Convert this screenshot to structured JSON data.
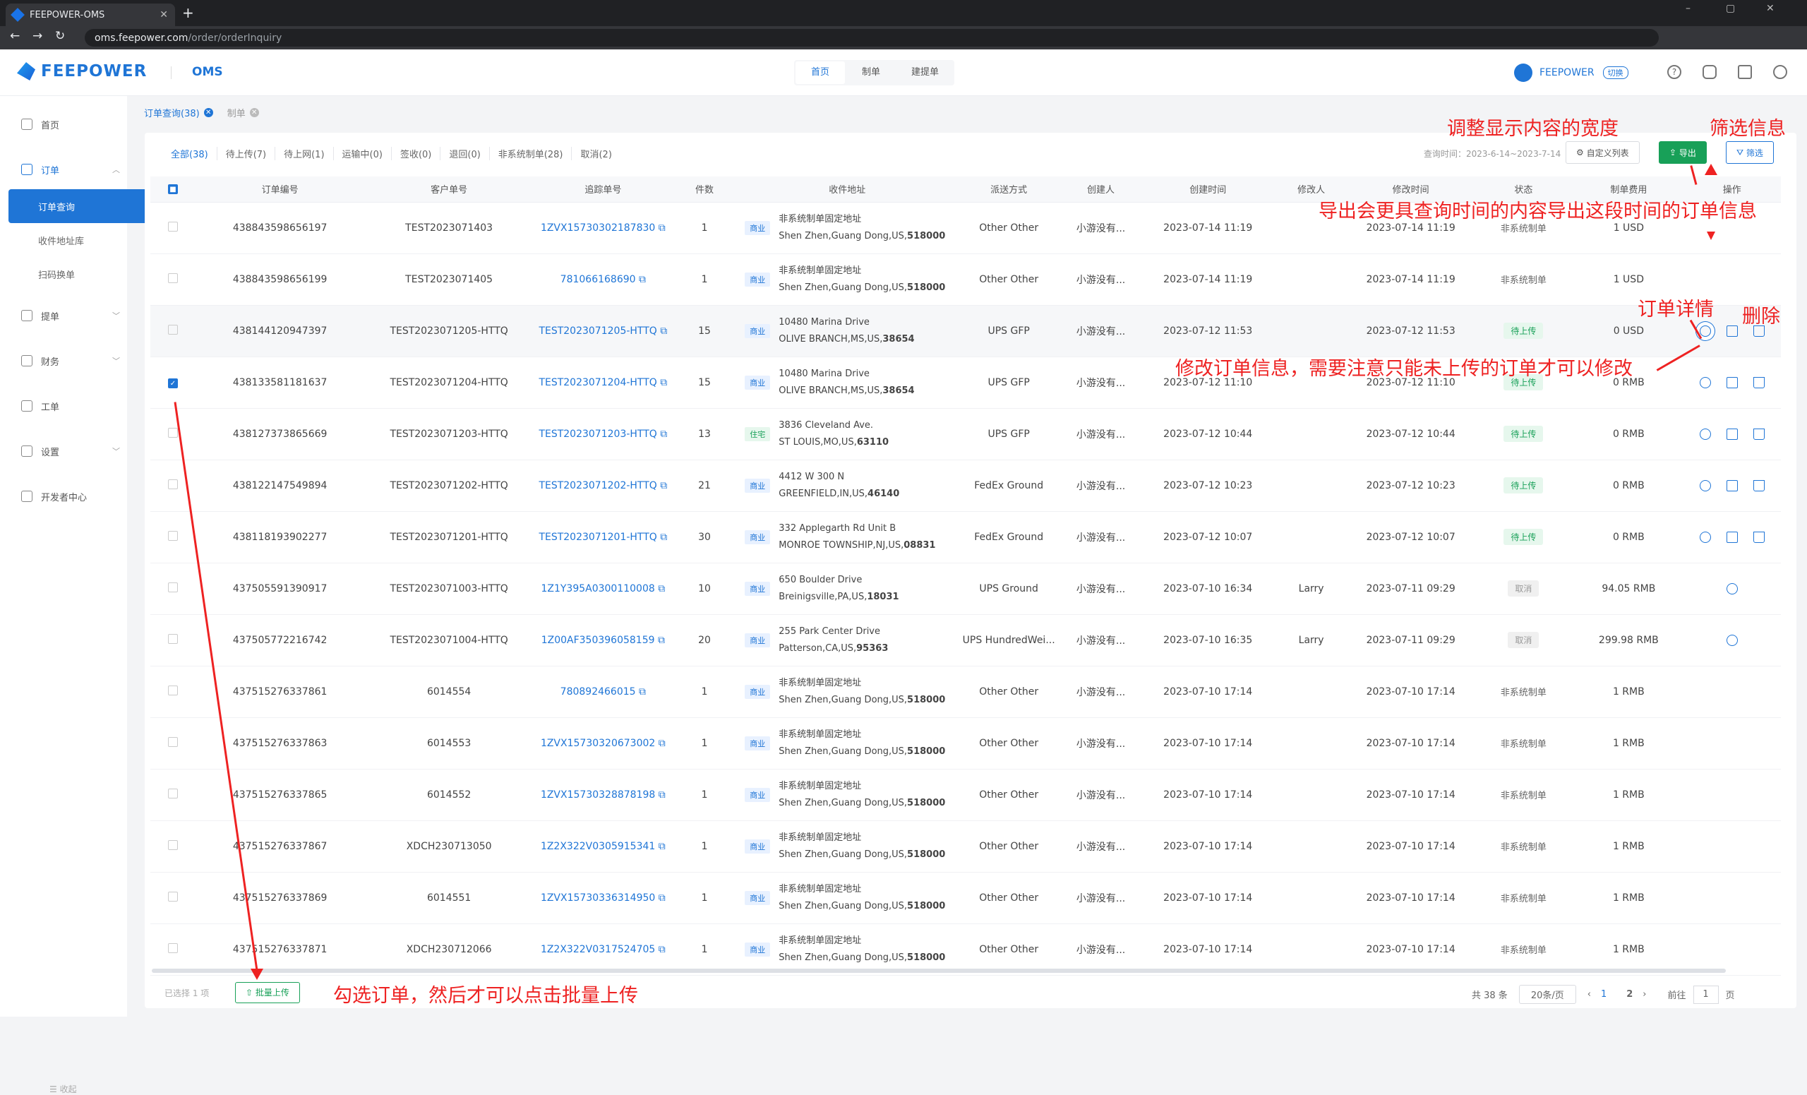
{
  "browser": {
    "tab_title": "FEEPOWER-OMS",
    "url_host": "oms.feepower.com",
    "url_path": "/order/orderInquiry"
  },
  "header": {
    "brand": "FEEPOWER",
    "product": "OMS",
    "nav": [
      "首页",
      "制单",
      "建提单"
    ],
    "user_name": "FEEPOWER",
    "switch_label": "切换"
  },
  "sidebar": {
    "items": [
      {
        "label": "首页",
        "icon": "home-icon"
      },
      {
        "label": "订单",
        "icon": "order-icon"
      },
      {
        "label": "提单",
        "icon": "bill-icon"
      },
      {
        "label": "财务",
        "icon": "finance-icon"
      },
      {
        "label": "工单",
        "icon": "ticket-icon"
      },
      {
        "label": "设置",
        "icon": "settings-icon"
      },
      {
        "label": "开发者中心",
        "icon": "developer-icon"
      }
    ],
    "sub_items": [
      "订单查询",
      "收件地址库",
      "扫码换单"
    ],
    "collapse_label": "收起"
  },
  "breadcrumbs": [
    "订单查询(38)",
    "制单"
  ],
  "filter_tabs": [
    "全部(38)",
    "待上传(7)",
    "待上网(1)",
    "运输中(0)",
    "签收(0)",
    "退回(0)",
    "非系统制单(28)",
    "取消(2)"
  ],
  "query_time": "查询时间：2023-6-14~2023-7-14",
  "toolbar": {
    "custom_columns": "自定义列表",
    "export": "导出",
    "filter": "筛选"
  },
  "columns": [
    "订单编号",
    "客户单号",
    "追踪单号",
    "件数",
    "收件地址",
    "派送方式",
    "创建人",
    "创建时间",
    "修改人",
    "修改时间",
    "状态",
    "制单费用",
    "操作"
  ],
  "rows": [
    {
      "checked": false,
      "id": "438843598656197",
      "cust": "TEST2023071403",
      "track": "1ZVX15730302187830",
      "qty": "1",
      "type": "商业",
      "addr1": "非系统制单固定地址",
      "addr2": "Shen Zhen,Guang Dong,US,",
      "zip": "518000",
      "method": "Other Other",
      "creator": "小游没有...",
      "created": "2023-07-14 11:19",
      "modifier": "",
      "modified": "2023-07-14 11:19",
      "status": "非系统制单",
      "status_kind": "none",
      "fee": "1 USD",
      "ops": 0
    },
    {
      "checked": false,
      "id": "438843598656199",
      "cust": "TEST2023071405",
      "track": "781066168690",
      "qty": "1",
      "type": "商业",
      "addr1": "非系统制单固定地址",
      "addr2": "Shen Zhen,Guang Dong,US,",
      "zip": "518000",
      "method": "Other Other",
      "creator": "小游没有...",
      "created": "2023-07-14 11:19",
      "modifier": "",
      "modified": "2023-07-14 11:19",
      "status": "非系统制单",
      "status_kind": "none",
      "fee": "1 USD",
      "ops": 0
    },
    {
      "checked": false,
      "id": "438144120947397",
      "cust": "TEST2023071205-HTTQ",
      "track": "TEST2023071205-HTTQ",
      "qty": "15",
      "type": "商业",
      "addr1": "10480 Marina Drive",
      "addr2": "OLIVE BRANCH,MS,US,",
      "zip": "38654",
      "method": "UPS GFP",
      "creator": "小游没有...",
      "created": "2023-07-12 11:53",
      "modifier": "",
      "modified": "2023-07-12 11:53",
      "status": "待上传",
      "status_kind": "up",
      "fee": "0 USD",
      "ops": 3,
      "hl": true
    },
    {
      "checked": true,
      "id": "438133581181637",
      "cust": "TEST2023071204-HTTQ",
      "track": "TEST2023071204-HTTQ",
      "qty": "15",
      "type": "商业",
      "addr1": "10480 Marina Drive",
      "addr2": "OLIVE BRANCH,MS,US,",
      "zip": "38654",
      "method": "UPS GFP",
      "creator": "小游没有...",
      "created": "2023-07-12 11:10",
      "modifier": "",
      "modified": "2023-07-12 11:10",
      "status": "待上传",
      "status_kind": "up",
      "fee": "0 RMB",
      "ops": 3
    },
    {
      "checked": false,
      "id": "438127373865669",
      "cust": "TEST2023071203-HTTQ",
      "track": "TEST2023071203-HTTQ",
      "qty": "13",
      "type": "住宅",
      "addr1": "3836 Cleveland Ave.",
      "addr2": "ST LOUIS,MO,US,",
      "zip": "63110",
      "method": "UPS GFP",
      "creator": "小游没有...",
      "created": "2023-07-12 10:44",
      "modifier": "",
      "modified": "2023-07-12 10:44",
      "status": "待上传",
      "status_kind": "up",
      "fee": "0 RMB",
      "ops": 3
    },
    {
      "checked": false,
      "id": "438122147549894",
      "cust": "TEST2023071202-HTTQ",
      "track": "TEST2023071202-HTTQ",
      "qty": "21",
      "type": "商业",
      "addr1": "4412 W 300 N",
      "addr2": "GREENFIELD,IN,US,",
      "zip": "46140",
      "method": "FedEx Ground",
      "creator": "小游没有...",
      "created": "2023-07-12 10:23",
      "modifier": "",
      "modified": "2023-07-12 10:23",
      "status": "待上传",
      "status_kind": "up",
      "fee": "0 RMB",
      "ops": 3
    },
    {
      "checked": false,
      "id": "438118193902277",
      "cust": "TEST2023071201-HTTQ",
      "track": "TEST2023071201-HTTQ",
      "qty": "30",
      "type": "商业",
      "addr1": "332 Applegarth Rd Unit B",
      "addr2": "MONROE TOWNSHIP,NJ,US,",
      "zip": "08831",
      "method": "FedEx Ground",
      "creator": "小游没有...",
      "created": "2023-07-12 10:07",
      "modifier": "",
      "modified": "2023-07-12 10:07",
      "status": "待上传",
      "status_kind": "up",
      "fee": "0 RMB",
      "ops": 3
    },
    {
      "checked": false,
      "id": "437505591390917",
      "cust": "TEST2023071003-HTTQ",
      "track": "1Z1Y395A0300110008",
      "qty": "10",
      "type": "商业",
      "addr1": "650 Boulder Drive",
      "addr2": "Breinigsville,PA,US,",
      "zip": "18031",
      "method": "UPS Ground",
      "creator": "小游没有...",
      "created": "2023-07-10 16:34",
      "modifier": "Larry",
      "modified": "2023-07-11 09:29",
      "status": "取消",
      "status_kind": "cx",
      "fee": "94.05 RMB",
      "ops": 1
    },
    {
      "checked": false,
      "id": "437505772216742",
      "cust": "TEST2023071004-HTTQ",
      "track": "1Z00AF350396058159",
      "qty": "20",
      "type": "商业",
      "addr1": "255 Park Center Drive",
      "addr2": "Patterson,CA,US,",
      "zip": "95363",
      "method": "UPS HundredWei...",
      "creator": "小游没有...",
      "created": "2023-07-10 16:35",
      "modifier": "Larry",
      "modified": "2023-07-11 09:29",
      "status": "取消",
      "status_kind": "cx",
      "fee": "299.98 RMB",
      "ops": 1
    },
    {
      "checked": false,
      "id": "437515276337861",
      "cust": "6014554",
      "track": "780892466015",
      "qty": "1",
      "type": "商业",
      "addr1": "非系统制单固定地址",
      "addr2": "Shen Zhen,Guang Dong,US,",
      "zip": "518000",
      "method": "Other Other",
      "creator": "小游没有...",
      "created": "2023-07-10 17:14",
      "modifier": "",
      "modified": "2023-07-10 17:14",
      "status": "非系统制单",
      "status_kind": "none",
      "fee": "1 RMB",
      "ops": 0
    },
    {
      "checked": false,
      "id": "437515276337863",
      "cust": "6014553",
      "track": "1ZVX15730320673002",
      "qty": "1",
      "type": "商业",
      "addr1": "非系统制单固定地址",
      "addr2": "Shen Zhen,Guang Dong,US,",
      "zip": "518000",
      "method": "Other Other",
      "creator": "小游没有...",
      "created": "2023-07-10 17:14",
      "modifier": "",
      "modified": "2023-07-10 17:14",
      "status": "非系统制单",
      "status_kind": "none",
      "fee": "1 RMB",
      "ops": 0
    },
    {
      "checked": false,
      "id": "437515276337865",
      "cust": "6014552",
      "track": "1ZVX15730328878198",
      "qty": "1",
      "type": "商业",
      "addr1": "非系统制单固定地址",
      "addr2": "Shen Zhen,Guang Dong,US,",
      "zip": "518000",
      "method": "Other Other",
      "creator": "小游没有...",
      "created": "2023-07-10 17:14",
      "modifier": "",
      "modified": "2023-07-10 17:14",
      "status": "非系统制单",
      "status_kind": "none",
      "fee": "1 RMB",
      "ops": 0
    },
    {
      "checked": false,
      "id": "437515276337867",
      "cust": "XDCH230713050",
      "track": "1Z2X322V0305915341",
      "qty": "1",
      "type": "商业",
      "addr1": "非系统制单固定地址",
      "addr2": "Shen Zhen,Guang Dong,US,",
      "zip": "518000",
      "method": "Other Other",
      "creator": "小游没有...",
      "created": "2023-07-10 17:14",
      "modifier": "",
      "modified": "2023-07-10 17:14",
      "status": "非系统制单",
      "status_kind": "none",
      "fee": "1 RMB",
      "ops": 0
    },
    {
      "checked": false,
      "id": "437515276337869",
      "cust": "6014551",
      "track": "1ZVX15730336314950",
      "qty": "1",
      "type": "商业",
      "addr1": "非系统制单固定地址",
      "addr2": "Shen Zhen,Guang Dong,US,",
      "zip": "518000",
      "method": "Other Other",
      "creator": "小游没有...",
      "created": "2023-07-10 17:14",
      "modifier": "",
      "modified": "2023-07-10 17:14",
      "status": "非系统制单",
      "status_kind": "none",
      "fee": "1 RMB",
      "ops": 0
    },
    {
      "checked": false,
      "id": "437515276337871",
      "cust": "XDCH230712066",
      "track": "1Z2X322V0317524705",
      "qty": "1",
      "type": "商业",
      "addr1": "非系统制单固定地址",
      "addr2": "Shen Zhen,Guang Dong,US,",
      "zip": "518000",
      "method": "Other Other",
      "creator": "小游没有...",
      "created": "2023-07-10 17:14",
      "modifier": "",
      "modified": "2023-07-10 17:14",
      "status": "非系统制单",
      "status_kind": "none",
      "fee": "1 RMB",
      "ops": 0
    }
  ],
  "footer": {
    "selected": "已选择 1 项",
    "batch_upload": "批量上传",
    "total": "共 38 条",
    "page_size": "20条/页",
    "pages": [
      "1",
      "2"
    ],
    "goto_label": "前往",
    "goto_value": "1",
    "page_suffix": "页"
  },
  "annotations": {
    "width": "调整显示内容的宽度",
    "filter": "筛选信息",
    "export": "导出会更具查询时间的内容导出这段时间的订单信息",
    "detail": "订单详情",
    "delete": "删除",
    "edit": "修改订单信息，需要注意只能未上传的订单才可以修改",
    "batch": "勾选订单，然后才可以点击批量上传"
  },
  "colors": {
    "primary": "#1f75d6",
    "success": "#18a058",
    "annotation": "#e22"
  }
}
